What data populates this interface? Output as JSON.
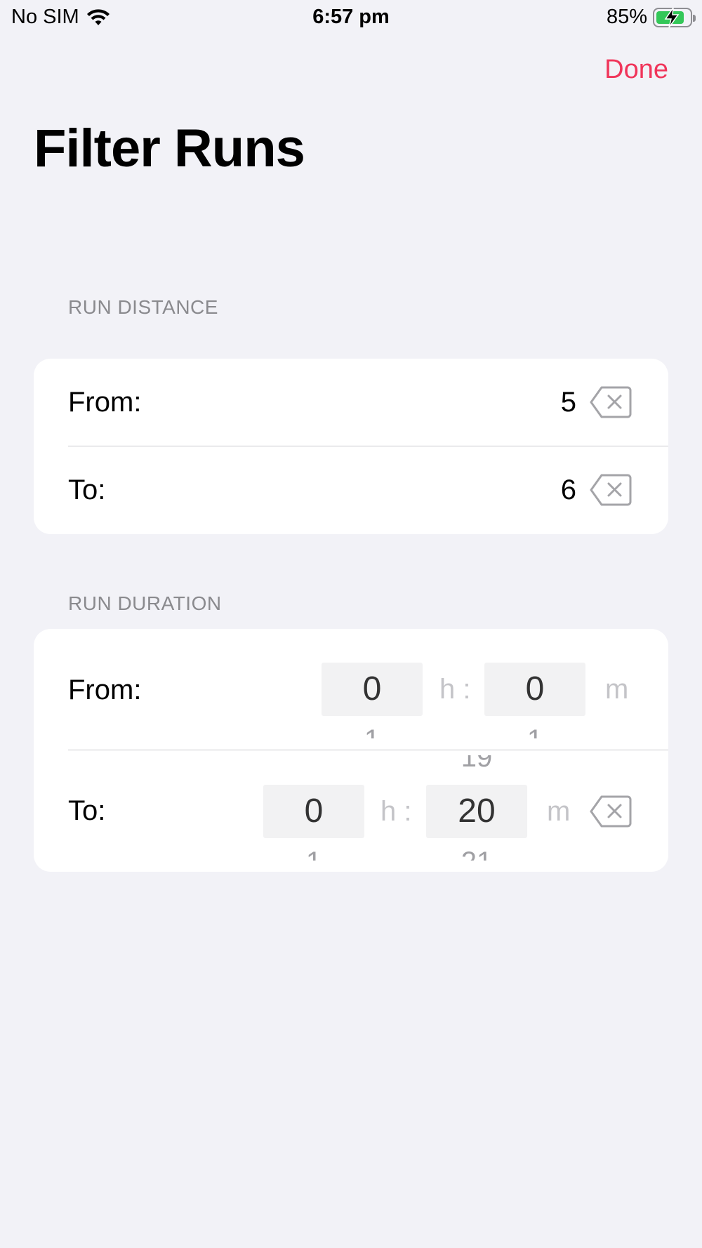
{
  "status_bar": {
    "carrier": "No SIM",
    "time": "6:57 pm",
    "battery_percent": "85%",
    "battery_level": 0.85,
    "battery_color": "#34c759"
  },
  "nav": {
    "done_label": "Done",
    "title": "Filter Runs",
    "accent_color": "#f0355a"
  },
  "run_distance": {
    "header": "RUN DISTANCE",
    "from_label": "From:",
    "from_value": "5",
    "to_label": "To:",
    "to_value": "6"
  },
  "run_duration": {
    "header": "RUN DURATION",
    "from": {
      "label": "From:",
      "hours": "0",
      "hours_next": "1",
      "hours_unit": "h :",
      "minutes": "0",
      "minutes_next": "1",
      "minutes_unit": "m"
    },
    "to": {
      "label": "To:",
      "hours": "0",
      "hours_next": "1",
      "hours_unit": "h :",
      "minutes_prev": "19",
      "minutes": "20",
      "minutes_next": "21",
      "minutes_unit": "m"
    }
  },
  "icons": {
    "clear": "delete-left-icon",
    "wifi": "wifi-icon",
    "battery": "battery-charging-icon"
  }
}
